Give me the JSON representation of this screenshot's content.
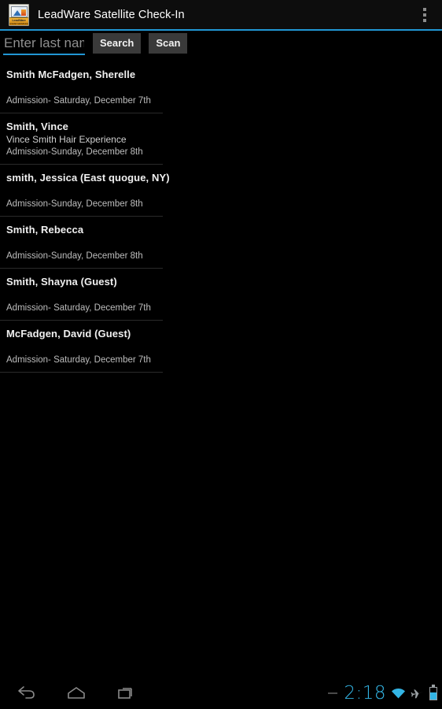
{
  "titlebar": {
    "app_title": "LeadWare Satellite Check-In",
    "icon_name": "leadware-app-icon",
    "icon_band_text": "LeadWare",
    "icon_band_subtext": "EVENT SERVICES",
    "overflow_icon": "overflow-menu-icon",
    "accent_color": "#2196d4"
  },
  "searchbar": {
    "input_value": "",
    "input_placeholder": "Enter last name",
    "search_label": "Search",
    "scan_label": "Scan",
    "underline_color": "#2196d4",
    "button_bg": "#3a3a3a"
  },
  "list": {
    "items": [
      {
        "name": "Smith McFadgen, Sherelle",
        "org": "",
        "admission": "Admission- Saturday, December 7th"
      },
      {
        "name": "Smith, Vince",
        "org": "Vince Smith Hair Experience",
        "admission": "Admission-Sunday, December 8th"
      },
      {
        "name": "smith, Jessica (East quogue, NY)",
        "org": "",
        "admission": "Admission-Sunday, December 8th"
      },
      {
        "name": "Smith, Rebecca",
        "org": "",
        "admission": "Admission-Sunday, December 8th"
      },
      {
        "name": "Smith, Shayna (Guest)",
        "org": "",
        "admission": "Admission- Saturday, December 7th"
      },
      {
        "name": "McFadgen, David (Guest)",
        "org": "",
        "admission": "Admission- Saturday, December 7th"
      }
    ]
  },
  "navbar": {
    "back_icon": "back-arrow-icon",
    "home_icon": "home-icon",
    "recents_icon": "recent-apps-icon"
  },
  "statusbar": {
    "time": "2:18",
    "time_color": "#33b5e5",
    "wifi_icon": "wifi-icon",
    "airplane_icon": "airplane-mode-icon",
    "battery_icon": "battery-icon",
    "battery_level_percent": 55
  }
}
